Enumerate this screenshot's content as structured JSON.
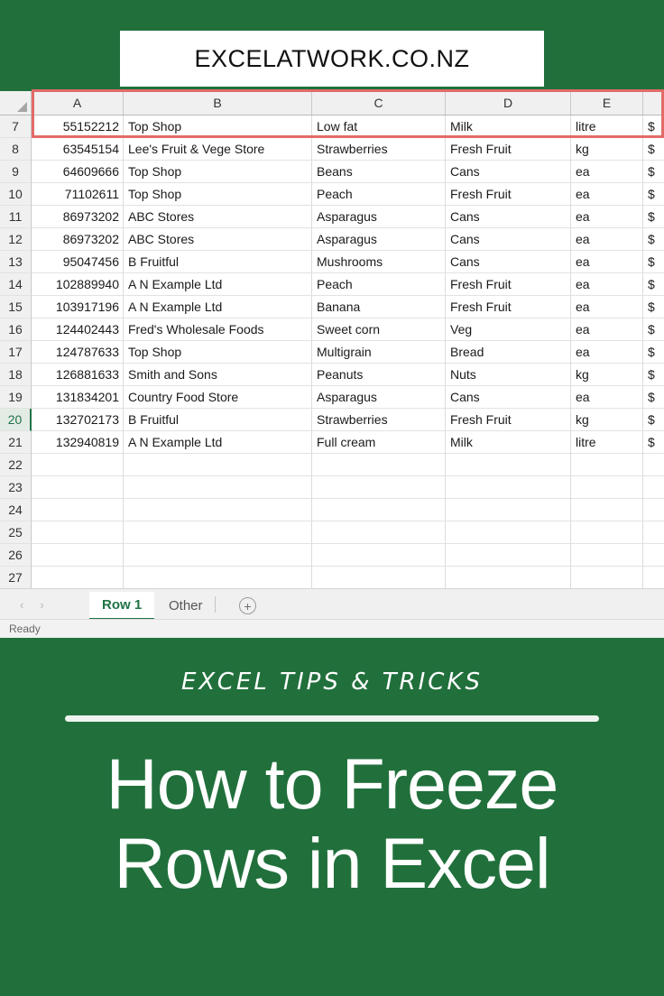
{
  "branding": {
    "site_url": "EXCELATWORK.CO.NZ",
    "green": "#21703C",
    "accent_red": "#E26B67",
    "excel_green": "#217346"
  },
  "pin": {
    "kicker": "EXCEL TIPS & TRICKS",
    "title_line1": "How to Freeze",
    "title_line2": "Rows in Excel"
  },
  "spreadsheet": {
    "column_headers": [
      "A",
      "B",
      "C",
      "D",
      "E"
    ],
    "row_numbers": [
      "7",
      "8",
      "9",
      "10",
      "11",
      "12",
      "13",
      "14",
      "15",
      "16",
      "17",
      "18",
      "19",
      "20",
      "21",
      "22",
      "23",
      "24",
      "25",
      "26",
      "27"
    ],
    "active_row": "20",
    "overflow_column_symbol": "$",
    "rows": [
      {
        "n": "7",
        "a": "55152212",
        "b": "Top Shop",
        "c": "Low fat",
        "d": "Milk",
        "e": "litre",
        "f": "$"
      },
      {
        "n": "8",
        "a": "63545154",
        "b": "Lee's Fruit & Vege Store",
        "c": "Strawberries",
        "d": "Fresh Fruit",
        "e": "kg",
        "f": "$"
      },
      {
        "n": "9",
        "a": "64609666",
        "b": "Top Shop",
        "c": "Beans",
        "d": "Cans",
        "e": "ea",
        "f": "$"
      },
      {
        "n": "10",
        "a": "71102611",
        "b": "Top Shop",
        "c": "Peach",
        "d": "Fresh Fruit",
        "e": "ea",
        "f": "$"
      },
      {
        "n": "11",
        "a": "86973202",
        "b": "ABC Stores",
        "c": "Asparagus",
        "d": "Cans",
        "e": "ea",
        "f": "$"
      },
      {
        "n": "12",
        "a": "86973202",
        "b": "ABC Stores",
        "c": "Asparagus",
        "d": "Cans",
        "e": "ea",
        "f": "$"
      },
      {
        "n": "13",
        "a": "95047456",
        "b": "B Fruitful",
        "c": "Mushrooms",
        "d": "Cans",
        "e": "ea",
        "f": "$"
      },
      {
        "n": "14",
        "a": "102889940",
        "b": "A N Example Ltd",
        "c": "Peach",
        "d": "Fresh Fruit",
        "e": "ea",
        "f": "$"
      },
      {
        "n": "15",
        "a": "103917196",
        "b": "A N Example Ltd",
        "c": "Banana",
        "d": "Fresh Fruit",
        "e": "ea",
        "f": "$"
      },
      {
        "n": "16",
        "a": "124402443",
        "b": "Fred's Wholesale Foods",
        "c": "Sweet corn",
        "d": "Veg",
        "e": "ea",
        "f": "$"
      },
      {
        "n": "17",
        "a": "124787633",
        "b": "Top Shop",
        "c": "Multigrain",
        "d": "Bread",
        "e": "ea",
        "f": "$"
      },
      {
        "n": "18",
        "a": "126881633",
        "b": "Smith and Sons",
        "c": "Peanuts",
        "d": "Nuts",
        "e": "kg",
        "f": "$"
      },
      {
        "n": "19",
        "a": "131834201",
        "b": "Country Food Store",
        "c": "Asparagus",
        "d": "Cans",
        "e": "ea",
        "f": "$"
      },
      {
        "n": "20",
        "a": "132702173",
        "b": "B Fruitful",
        "c": "Strawberries",
        "d": "Fresh Fruit",
        "e": "kg",
        "f": "$"
      },
      {
        "n": "21",
        "a": "132940819",
        "b": "A N Example Ltd",
        "c": "Full cream",
        "d": "Milk",
        "e": "litre",
        "f": "$"
      },
      {
        "n": "22",
        "a": "",
        "b": "",
        "c": "",
        "d": "",
        "e": "",
        "f": ""
      },
      {
        "n": "23",
        "a": "",
        "b": "",
        "c": "",
        "d": "",
        "e": "",
        "f": ""
      },
      {
        "n": "24",
        "a": "",
        "b": "",
        "c": "",
        "d": "",
        "e": "",
        "f": ""
      },
      {
        "n": "25",
        "a": "",
        "b": "",
        "c": "",
        "d": "",
        "e": "",
        "f": ""
      },
      {
        "n": "26",
        "a": "",
        "b": "",
        "c": "",
        "d": "",
        "e": "",
        "f": ""
      },
      {
        "n": "27",
        "a": "",
        "b": "",
        "c": "",
        "d": "",
        "e": "",
        "f": ""
      }
    ]
  },
  "tabs": {
    "prev_label": "‹",
    "next_label": "›",
    "sheets": [
      {
        "label": "Row 1",
        "active": true
      },
      {
        "label": "Other",
        "active": false
      }
    ],
    "add_label": "+"
  },
  "status": {
    "text": "Ready"
  }
}
